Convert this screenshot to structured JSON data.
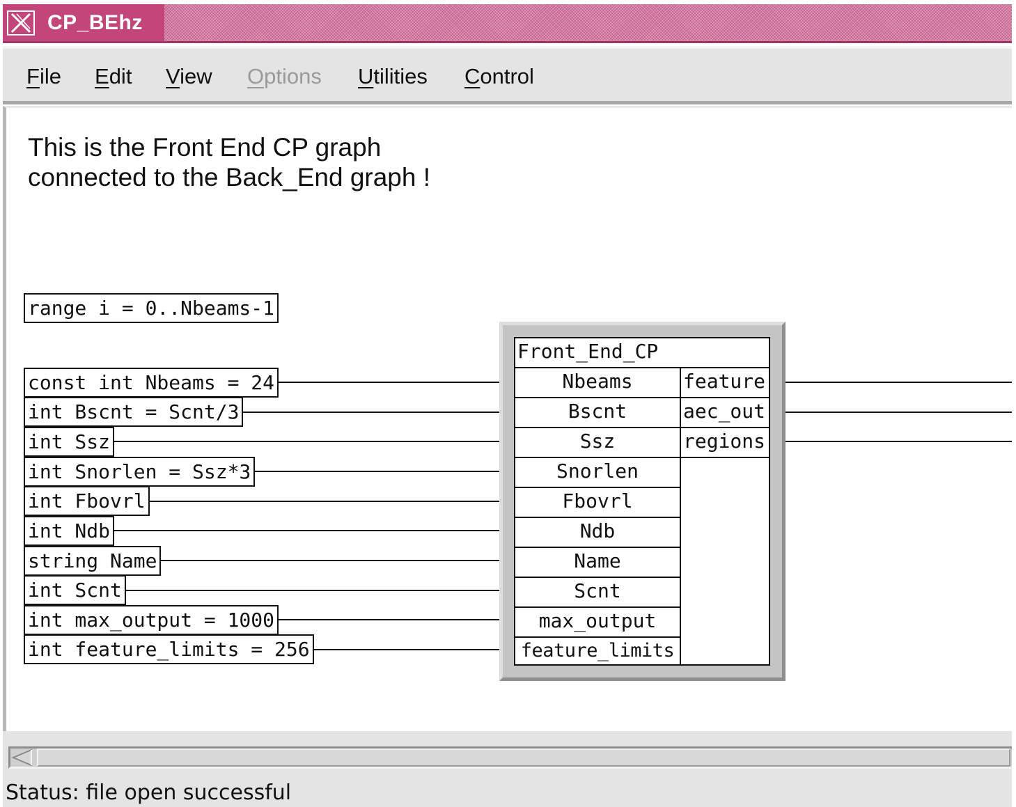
{
  "window": {
    "title": "CP_BEhz",
    "icon": "x-window-icon"
  },
  "menubar": {
    "items": [
      {
        "label": "File",
        "mnemonic": "F",
        "rest": "ile",
        "enabled": true
      },
      {
        "label": "Edit",
        "mnemonic": "E",
        "rest": "dit",
        "enabled": true
      },
      {
        "label": "View",
        "mnemonic": "V",
        "rest": "iew",
        "enabled": true
      },
      {
        "label": "Options",
        "mnemonic": "O",
        "rest": "ptions",
        "enabled": false
      },
      {
        "label": "Utilities",
        "mnemonic": "U",
        "rest": "tilities",
        "enabled": true
      },
      {
        "label": "Control",
        "mnemonic": "C",
        "rest": "ontrol",
        "enabled": true
      }
    ]
  },
  "canvas": {
    "comment": [
      "This is the Front End CP graph",
      "connected to the Back_End graph !"
    ],
    "range": "range i = 0..Nbeams-1",
    "params": [
      "const int Nbeams = 24",
      "int Bscnt = Scnt/3",
      "int Ssz",
      "int Snorlen = Ssz*3",
      "int Fbovrl",
      "int Ndb",
      "string Name",
      "int Scnt",
      "int max_output = 1000",
      "int feature_limits = 256"
    ],
    "block": {
      "name": "Front_End_CP",
      "inputs": [
        "Nbeams",
        "Bscnt",
        "Ssz",
        "Snorlen",
        "Fbovrl",
        "Ndb",
        "Name",
        "Scnt",
        "max_output",
        "feature_limits"
      ],
      "outputs": [
        "feature",
        "aec_out",
        "regions"
      ]
    }
  },
  "status": {
    "text": "Status: file open successful"
  }
}
